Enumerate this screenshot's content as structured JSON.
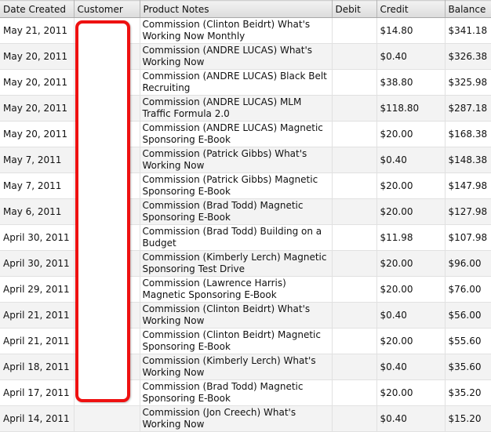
{
  "columns": {
    "date": "Date Created",
    "customer": "Customer",
    "notes": "Product Notes",
    "debit": "Debit",
    "credit": "Credit",
    "balance": "Balance"
  },
  "rows": [
    {
      "date": "May 21, 2011",
      "notes": "Commission (Clinton Beidrt) What's Working Now Monthly",
      "debit": "",
      "credit": "$14.80",
      "balance": "$341.18"
    },
    {
      "date": "May 20, 2011",
      "notes": "Commission (ANDRE LUCAS) What's Working Now",
      "debit": "",
      "credit": "$0.40",
      "balance": "$326.38"
    },
    {
      "date": "May 20, 2011",
      "notes": "Commission (ANDRE LUCAS) Black Belt Recruiting",
      "debit": "",
      "credit": "$38.80",
      "balance": "$325.98"
    },
    {
      "date": "May 20, 2011",
      "notes": "Commission (ANDRE LUCAS) MLM Traffic Formula 2.0",
      "debit": "",
      "credit": "$118.80",
      "balance": "$287.18"
    },
    {
      "date": "May 20, 2011",
      "notes": "Commission (ANDRE LUCAS) Magnetic Sponsoring E-Book",
      "debit": "",
      "credit": "$20.00",
      "balance": "$168.38"
    },
    {
      "date": "May 7, 2011",
      "notes": "Commission (Patrick Gibbs) What's Working Now",
      "debit": "",
      "credit": "$0.40",
      "balance": "$148.38"
    },
    {
      "date": "May 7, 2011",
      "notes": "Commission (Patrick Gibbs) Magnetic Sponsoring E-Book",
      "debit": "",
      "credit": "$20.00",
      "balance": "$147.98"
    },
    {
      "date": "May 6, 2011",
      "notes": "Commission (Brad Todd) Magnetic Sponsoring E-Book",
      "debit": "",
      "credit": "$20.00",
      "balance": "$127.98"
    },
    {
      "date": "April 30, 2011",
      "notes": "Commission (Brad Todd) Building on a Budget",
      "debit": "",
      "credit": "$11.98",
      "balance": "$107.98"
    },
    {
      "date": "April 30, 2011",
      "notes": "Commission (Kimberly Lerch) Magnetic Sponsoring Test Drive",
      "debit": "",
      "credit": "$20.00",
      "balance": "$96.00"
    },
    {
      "date": "April 29, 2011",
      "notes": "Commission (Lawrence Harris) Magnetic Sponsoring E-Book",
      "debit": "",
      "credit": "$20.00",
      "balance": "$76.00"
    },
    {
      "date": "April 21, 2011",
      "notes": "Commission (Clinton Beidrt) What's Working Now",
      "debit": "",
      "credit": "$0.40",
      "balance": "$56.00"
    },
    {
      "date": "April 21, 2011",
      "notes": "Commission (Clinton Beidrt) Magnetic Sponsoring E-Book",
      "debit": "",
      "credit": "$20.00",
      "balance": "$55.60"
    },
    {
      "date": "April 18, 2011",
      "notes": "Commission (Kimberly Lerch) What's Working Now",
      "debit": "",
      "credit": "$0.40",
      "balance": "$35.60"
    },
    {
      "date": "April 17, 2011",
      "notes": "Commission (Brad Todd) Magnetic Sponsoring E-Book",
      "debit": "",
      "credit": "$20.00",
      "balance": "$35.20"
    },
    {
      "date": "April 14, 2011",
      "notes": "Commission (Jon Creech) What's Working Now",
      "debit": "",
      "credit": "$0.40",
      "balance": "$15.20"
    }
  ],
  "colors": {
    "redaction_border": "#ee1111",
    "row_alt": "#f3f3f3"
  }
}
